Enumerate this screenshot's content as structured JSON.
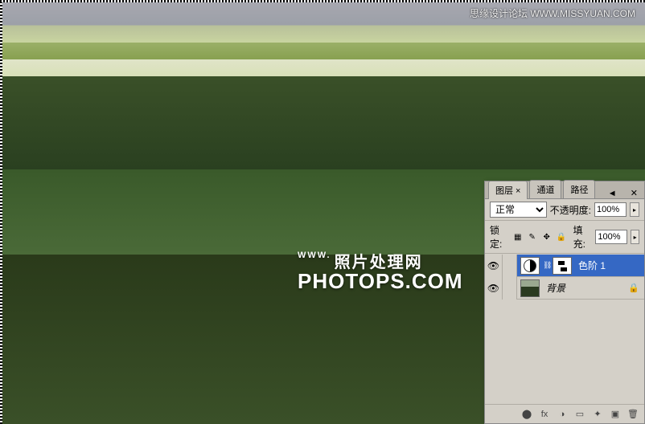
{
  "watermark_top": "思缘设计论坛  WWW.MISSYUAN.COM",
  "watermark_center_www": "WWW.",
  "watermark_center_cn": "照片处理网",
  "watermark_center_en": "PHOTOPS.COM",
  "panel": {
    "tabs": {
      "layers": "图层 ×",
      "channels": "通道",
      "paths": "路径"
    },
    "blend_mode": "正常",
    "opacity_label": "不透明度:",
    "opacity_value": "100%",
    "lock_label": "锁定:",
    "fill_label": "填充:",
    "fill_value": "100%",
    "layers": [
      {
        "name": "色阶 1",
        "type": "adjustment",
        "visible": true,
        "selected": true,
        "locked": false
      },
      {
        "name": "背景",
        "type": "image",
        "visible": true,
        "selected": false,
        "locked": true
      }
    ],
    "footer_icons": [
      "fx",
      "◑",
      "▭",
      "✦",
      "▣",
      "🗑"
    ]
  }
}
